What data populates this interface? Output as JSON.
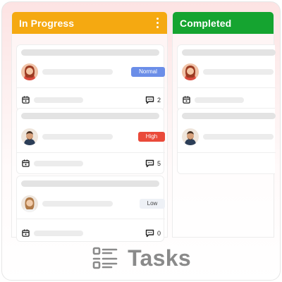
{
  "board": {
    "columns": [
      {
        "title": "In Progress",
        "color": "#f5a911"
      },
      {
        "title": "Completed",
        "color": "#15a430"
      }
    ]
  },
  "cards": {
    "card1": {
      "priority": "Normal",
      "comments": "2"
    },
    "card2": {
      "priority": "High",
      "comments": "5"
    },
    "card3": {
      "priority": "Low",
      "comments": "0"
    }
  },
  "footer": {
    "title": "Tasks",
    "icon": "task-list-icon"
  },
  "colors": {
    "normal": "#6b8ee8",
    "high": "#ea4a3a",
    "low": "#eef1f6"
  }
}
